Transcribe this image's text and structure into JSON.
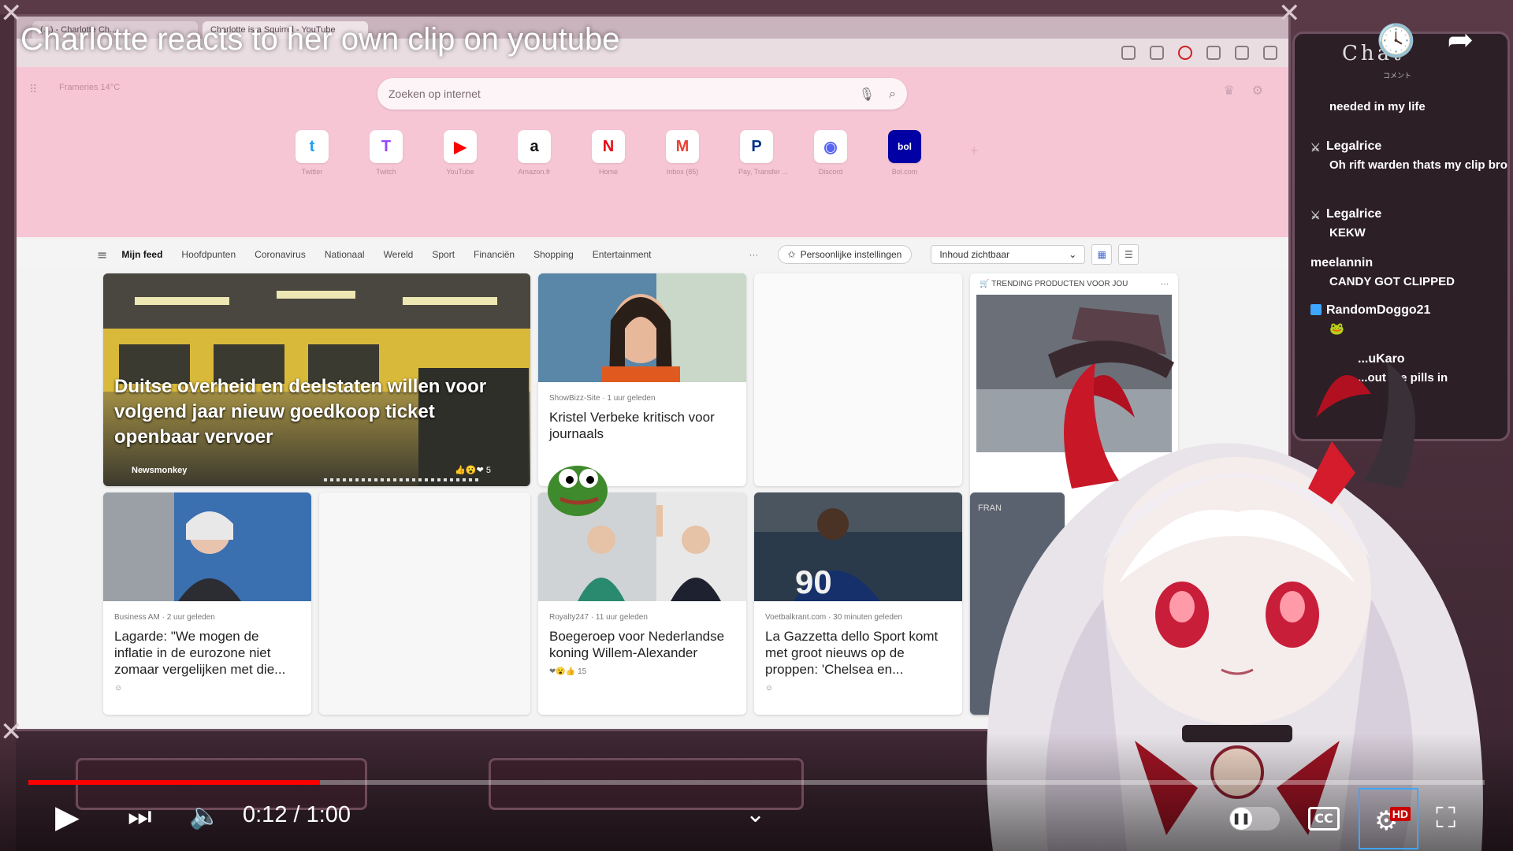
{
  "video": {
    "title": "Charlotte reacts to her own clip on youtube",
    "time_current": "0:12",
    "time_total": "1:00",
    "time_display": "0:12 / 1:00",
    "progress_fraction": 0.2,
    "hd_label": "HD"
  },
  "browser": {
    "tabs": [
      "(...) - Charlotte Ch...",
      "Charlotte is a Squirrel - YouTube"
    ],
    "weather": "Frameries  14°C",
    "search_placeholder": "Zoeken op internet",
    "quicklinks": [
      {
        "label": "Twitter",
        "glyph": "t",
        "color": "#1da1f2"
      },
      {
        "label": "Twitch",
        "glyph": "T",
        "color": "#9146ff"
      },
      {
        "label": "YouTube",
        "glyph": "▶",
        "color": "#ff0000"
      },
      {
        "label": "Amazon.fr",
        "glyph": "a",
        "color": "#111111"
      },
      {
        "label": "Home",
        "glyph": "N",
        "color": "#e50914"
      },
      {
        "label": "Inbox (85)",
        "glyph": "M",
        "color": "#ea4335"
      },
      {
        "label": "Pay, Transfer ...",
        "glyph": "P",
        "color": "#003087"
      },
      {
        "label": "Discord",
        "glyph": "◉",
        "color": "#5865f2"
      },
      {
        "label": "Bol.com",
        "glyph": "bol",
        "color": "#0000a4"
      }
    ],
    "feed_tabs": [
      "Mijn feed",
      "Hoofdpunten",
      "Coronavirus",
      "Nationaal",
      "Wereld",
      "Sport",
      "Financiën",
      "Shopping",
      "Entertainment"
    ],
    "more": "···",
    "personal_settings": "Persoonlijke instellingen",
    "content_visible": "Inhoud zichtbaar"
  },
  "cards": {
    "hero": {
      "title": "Duitse overheid en deelstaten willen voor volgend jaar nieuw goedkoop ticket openbaar vervoer",
      "source": "Newsmonkey",
      "reactions": "5"
    },
    "kristel": {
      "meta": "ShowBizz-Site · 1 uur geleden",
      "title": "Kristel Verbeke kritisch voor journaals"
    },
    "trending": {
      "label": "TRENDING PRODUCTEN VOOR JOU"
    },
    "lagarde": {
      "meta": "Business AM · 2 uur geleden",
      "title": "Lagarde: \"We mogen de inflatie in de eurozone niet zomaar vergelijken met die..."
    },
    "koning": {
      "meta": "Royalty247 · 11 uur geleden",
      "title": "Boegeroep voor Nederlandse koning Willem-Alexander",
      "reactions": "15"
    },
    "gazzetta": {
      "meta": "Voetbalkrant.com · 30 minuten geleden",
      "title": "La Gazzetta dello Sport komt met groot nieuws op de proppen: 'Chelsea en..."
    },
    "partial": {
      "label": "FRAN"
    }
  },
  "chat": {
    "title": "Chat",
    "subtitle": "コメント",
    "messages": [
      {
        "user": "",
        "text": "needed in my life"
      },
      {
        "user": "Legalrice",
        "text": "Oh rift warden thats my clip bro"
      },
      {
        "user": "Legalrice",
        "text": "KEKW"
      },
      {
        "user": "meelannin",
        "text": "CANDY GOT CLIPPED"
      },
      {
        "user": "RandomDoggo21",
        "text": ""
      },
      {
        "user": "...uKaro",
        "text": "...out the pills in"
      }
    ]
  },
  "colors": {
    "accent": "#ff0000",
    "newtab_bg": "#f7c6d4",
    "chat_bg": "#2d1f26"
  }
}
